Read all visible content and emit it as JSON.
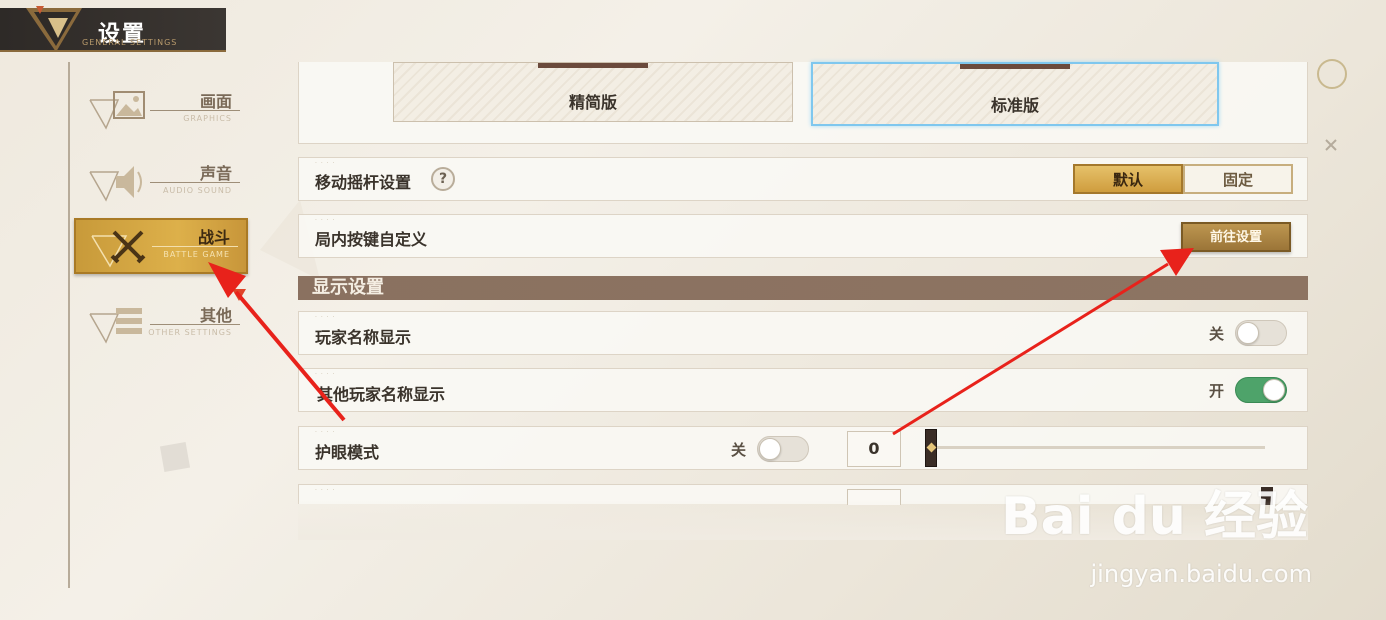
{
  "header": {
    "title": "设置",
    "subtitle": "GENERAL SETTINGS"
  },
  "sidebar": {
    "items": [
      {
        "label": "画面",
        "sub": "GRAPHICS",
        "icon": "image-icon",
        "active": false
      },
      {
        "label": "声音",
        "sub": "AUDIO SOUND",
        "icon": "sound-icon",
        "active": false
      },
      {
        "label": "战斗",
        "sub": "BATTLE GAME",
        "icon": "battle-swords-icon",
        "active": true
      },
      {
        "label": "其他",
        "sub": "OTHER SETTINGS",
        "icon": "list-icon",
        "active": false,
        "badge": true
      }
    ]
  },
  "main": {
    "presets": [
      {
        "label": "精简版",
        "selected": false
      },
      {
        "label": "标准版",
        "selected": true
      }
    ],
    "joystick": {
      "label": "移动摇杆设置",
      "help": "?",
      "options": [
        "默认",
        "固定"
      ],
      "selected": "默认"
    },
    "custom_keys": {
      "label": "局内按键自定义",
      "button": "前往设置"
    },
    "display_section": {
      "title": "显示设置"
    },
    "player_name": {
      "label": "玩家名称显示",
      "state_label": "关",
      "on": false
    },
    "other_player_name": {
      "label": "其他玩家名称显示",
      "state_label": "开",
      "on": true
    },
    "eye_care": {
      "label": "护眼模式",
      "state_label": "关",
      "on": false,
      "value": "0",
      "slider_fraction": 0
    }
  },
  "watermark": {
    "text": "Bai du 经验",
    "url": "jingyan.baidu.com"
  },
  "colors": {
    "accent_gold": "#ddb04a",
    "section_brown": "#8a7160",
    "toggle_on": "#4ea36a",
    "preset_selected": "#7fc7ee",
    "arrow_red": "#e8221b"
  }
}
